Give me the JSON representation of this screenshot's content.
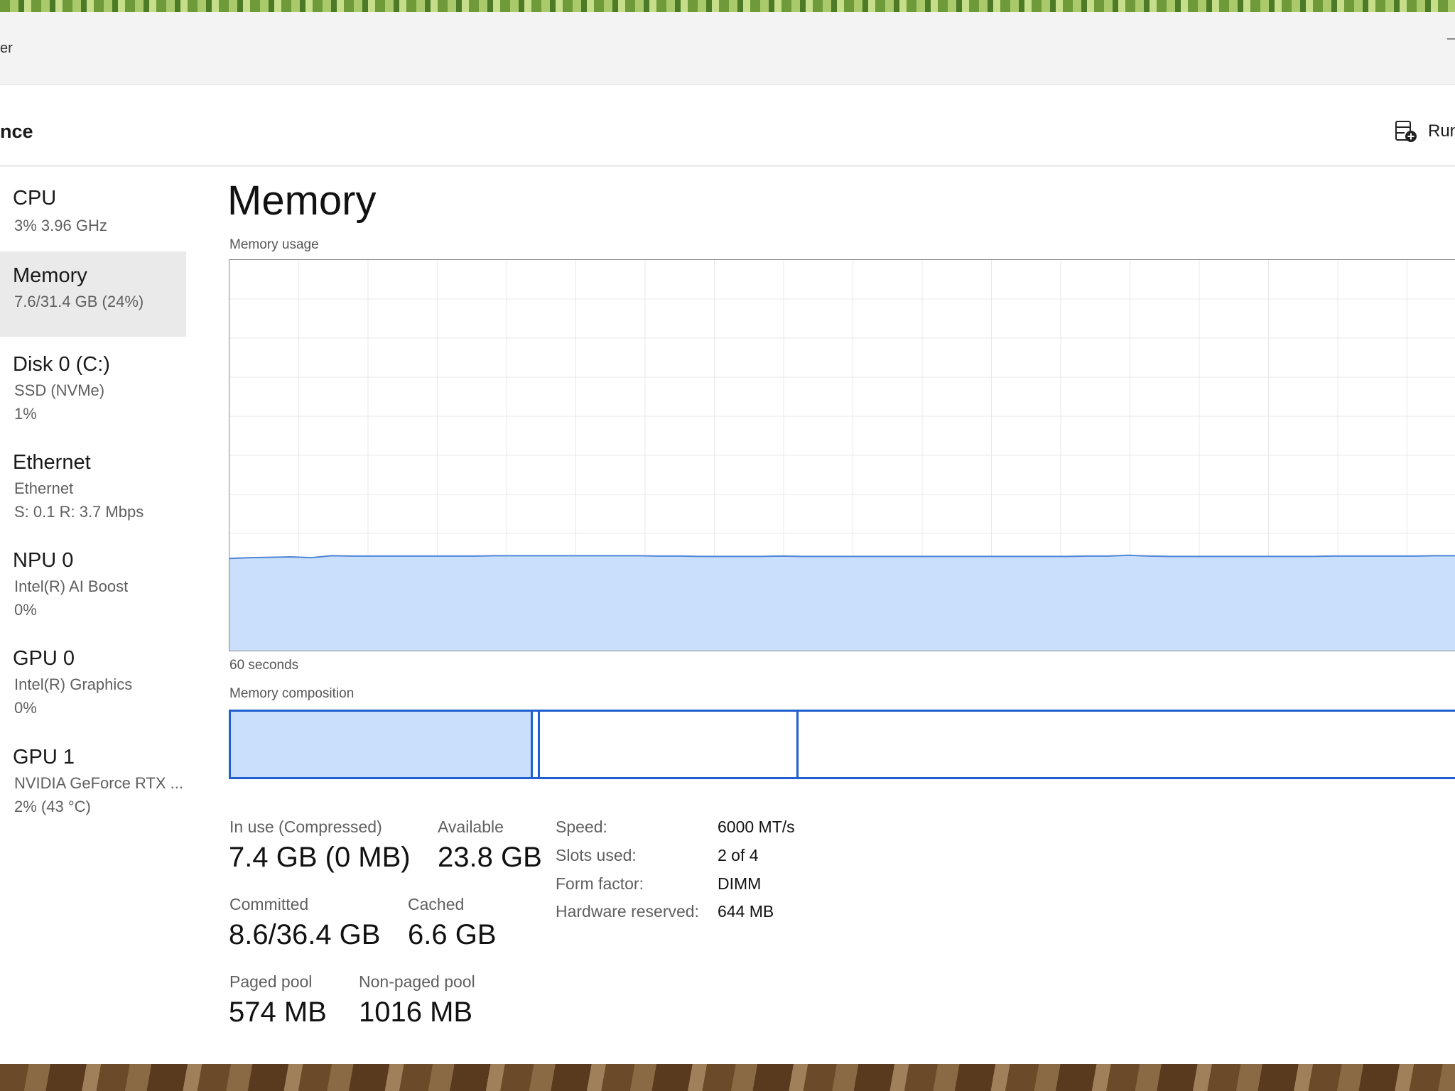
{
  "window": {
    "app_title": "er",
    "minimize_glyph": "–"
  },
  "toolbar": {
    "page_heading": "nce",
    "run_task_label": "Run",
    "run_task_icon": "run-new-task-icon"
  },
  "sidebar": {
    "items": [
      {
        "name": "CPU",
        "lines": [
          "3%  3.96 GHz"
        ]
      },
      {
        "name": "Memory",
        "lines": [
          "7.6/31.4 GB (24%)"
        ]
      },
      {
        "name": "Disk 0 (C:)",
        "lines": [
          "SSD (NVMe)",
          "1%"
        ]
      },
      {
        "name": "Ethernet",
        "lines": [
          "Ethernet",
          "S: 0.1  R: 3.7 Mbps"
        ]
      },
      {
        "name": "NPU 0",
        "lines": [
          "Intel(R) AI Boost",
          "0%"
        ]
      },
      {
        "name": "GPU 0",
        "lines": [
          "Intel(R) Graphics",
          "0%"
        ]
      },
      {
        "name": "GPU 1",
        "lines": [
          "NVIDIA GeForce RTX ...",
          "2%  (43 °C)"
        ]
      }
    ]
  },
  "main": {
    "title": "Memory",
    "usage_label": "Memory usage",
    "time_label": "60 seconds",
    "composition_label": "Memory composition"
  },
  "colors": {
    "accent": "#1f5fcf",
    "graph_fill": "#c9dffb",
    "graph_line": "#4f86d6",
    "grid": "#e8e8e8"
  },
  "chart_data": {
    "type": "area",
    "title": "Memory usage",
    "xlabel": "60 seconds",
    "ylabel": "",
    "ylim": [
      0,
      100
    ],
    "x": [
      0,
      1,
      2,
      3,
      4,
      5,
      6,
      7,
      8,
      9,
      10,
      11,
      12,
      13,
      14,
      15,
      16,
      17,
      18,
      19,
      20,
      21,
      22,
      23,
      24,
      25,
      26,
      27,
      28,
      29,
      30,
      31,
      32,
      33,
      34,
      35,
      36,
      37,
      38,
      39,
      40,
      41,
      42,
      43,
      44,
      45,
      46,
      47,
      48,
      49,
      50,
      51,
      52,
      53,
      54,
      55,
      56,
      57,
      58,
      59,
      60
    ],
    "values": [
      23.6,
      23.8,
      23.9,
      24.0,
      23.8,
      24.3,
      24.2,
      24.2,
      24.2,
      24.2,
      24.2,
      24.2,
      24.2,
      24.3,
      24.3,
      24.3,
      24.3,
      24.3,
      24.3,
      24.3,
      24.3,
      24.2,
      24.2,
      24.1,
      24.1,
      24.1,
      24.1,
      24.2,
      24.1,
      24.1,
      24.1,
      24.1,
      24.1,
      24.1,
      24.1,
      24.1,
      24.1,
      24.1,
      24.1,
      24.1,
      24.1,
      24.1,
      24.2,
      24.2,
      24.4,
      24.2,
      24.1,
      24.1,
      24.1,
      24.1,
      24.1,
      24.1,
      24.1,
      24.1,
      24.2,
      24.2,
      24.2,
      24.2,
      24.2,
      24.3,
      24.3
    ]
  },
  "composition": {
    "segments": [
      {
        "name": "in-use",
        "fraction": 0.245
      },
      {
        "name": "modified",
        "fraction": 0.006
      },
      {
        "name": "standby",
        "fraction": 0.211
      },
      {
        "name": "free",
        "fraction": 0.538
      }
    ]
  },
  "stats": {
    "in_use_label": "In use (Compressed)",
    "in_use_value": "7.4 GB (0 MB)",
    "available_label": "Available",
    "available_value": "23.8 GB",
    "committed_label": "Committed",
    "committed_value": "8.6/36.4 GB",
    "cached_label": "Cached",
    "cached_value": "6.6 GB",
    "paged_label": "Paged pool",
    "paged_value": "574 MB",
    "nonpaged_label": "Non-paged pool",
    "nonpaged_value": "1016 MB"
  },
  "properties": [
    {
      "label": "Speed:",
      "value": "6000 MT/s"
    },
    {
      "label": "Slots used:",
      "value": "2 of 4"
    },
    {
      "label": "Form factor:",
      "value": "DIMM"
    },
    {
      "label": "Hardware reserved:",
      "value": "644 MB"
    }
  ]
}
